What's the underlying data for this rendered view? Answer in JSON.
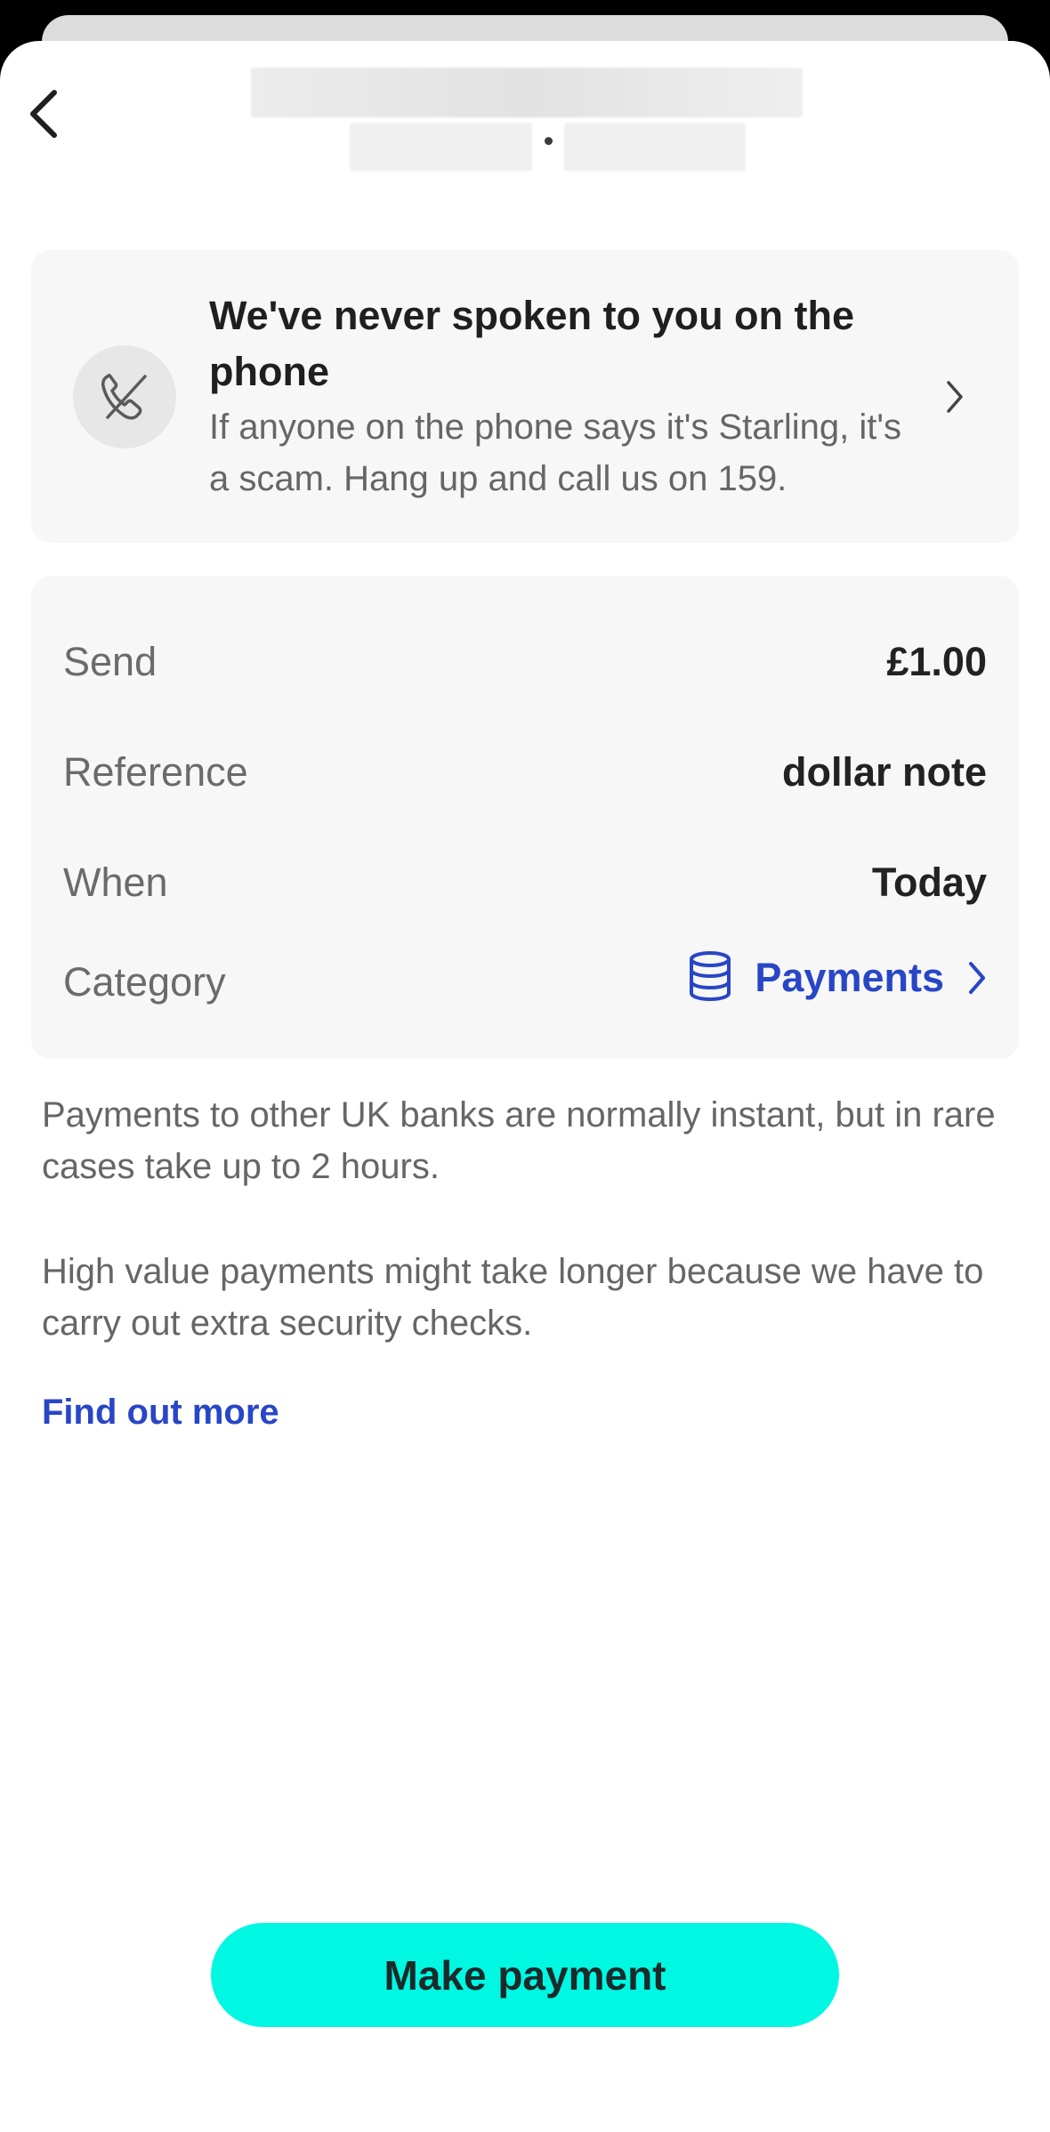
{
  "scam_banner": {
    "title": "We've never spoken to you on the phone",
    "body": "If anyone on the phone says it's Starling, it's a scam. Hang up and call us on 159.",
    "icon": "phone-crossed-icon"
  },
  "details": {
    "send": {
      "label": "Send",
      "value": "£1.00"
    },
    "reference": {
      "label": "Reference",
      "value": "dollar note"
    },
    "when": {
      "label": "When",
      "value": "Today"
    },
    "category": {
      "label": "Category",
      "value": "Payments",
      "icon": "coins-stack-icon"
    }
  },
  "info": {
    "paragraph1": "Payments to other UK banks are normally instant, but in rare cases take up to 2 hours.",
    "paragraph2": "High value payments might take longer because we have to carry out extra security checks.",
    "link": "Find out more"
  },
  "primary_button": "Make payment",
  "colors": {
    "accent_blue": "#2846c6",
    "button_teal": "#00f7e2",
    "card_bg": "#f7f7f7"
  }
}
